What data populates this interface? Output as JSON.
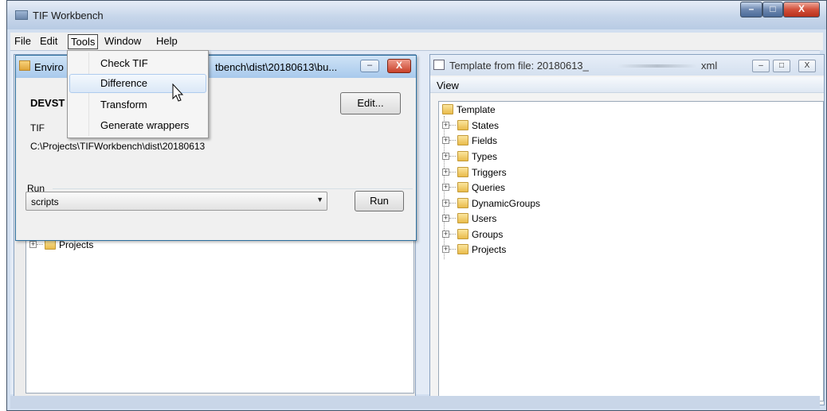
{
  "window": {
    "title": "TIF Workbench",
    "min_label": "–",
    "max_label": "□",
    "close_label": "X"
  },
  "menubar": {
    "items": [
      "File",
      "Edit",
      "Tools",
      "Window",
      "Help"
    ]
  },
  "tools_menu": {
    "items": [
      "Check TIF",
      "Difference",
      "Transform",
      "Generate wrappers"
    ],
    "highlighted": "Difference"
  },
  "env_dialog": {
    "title_start": "Enviro",
    "title_end": "tbench\\dist\\20180613\\bu...",
    "name": "DEVST",
    "type": "TIF",
    "path": "C:\\Projects\\TIFWorkbench\\dist\\20180613",
    "edit_label": "Edit...",
    "run_group_label": "Run",
    "script_select_value": "scripts",
    "run_label": "Run",
    "min_label": "–",
    "close_label": "X"
  },
  "left_tree": {
    "nodes": [
      {
        "label": "Projects",
        "expander": "+"
      }
    ]
  },
  "right_panel": {
    "title": "Template from file: 20180613_",
    "title_tail": "xml",
    "view_label": "View",
    "min_label": "–",
    "max_label": "□",
    "close_label": "X",
    "tree": {
      "root": "Template",
      "children": [
        "States",
        "Fields",
        "Types",
        "Triggers",
        "Queries",
        "DynamicGroups",
        "Users",
        "Groups",
        "Projects"
      ]
    }
  }
}
